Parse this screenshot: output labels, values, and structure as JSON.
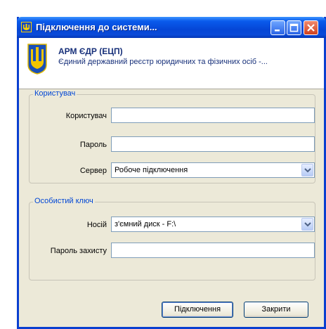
{
  "window": {
    "title": "Підключення до системи..."
  },
  "header": {
    "app_name": "АРМ ЄДР (ЕЦП)",
    "app_desc": "Єдиний державний реєстр юридичних та фізичних осіб -..."
  },
  "user_group": {
    "legend": "Користувач",
    "user_label": "Користувач",
    "user_value": "",
    "password_label": "Пароль",
    "password_value": "",
    "server_label": "Сервер",
    "server_value": "Робоче підключення"
  },
  "key_group": {
    "legend": "Особистий ключ",
    "carrier_label": "Носій",
    "carrier_value": "з'ємний диск - F:\\",
    "protect_label": "Пароль захисту",
    "protect_value": ""
  },
  "buttons": {
    "connect": "Підключення",
    "close": "Закрити"
  },
  "colors": {
    "titlebar": "#0a5bec",
    "accent_text": "#0046d5",
    "header_text": "#17307a",
    "window_bg": "#ece9d8"
  },
  "icons": {
    "title": "trident-icon",
    "logo": "trident-logo",
    "minimize": "minimize-icon",
    "maximize": "maximize-icon",
    "close": "close-icon",
    "dropdown": "chevron-down-icon"
  }
}
